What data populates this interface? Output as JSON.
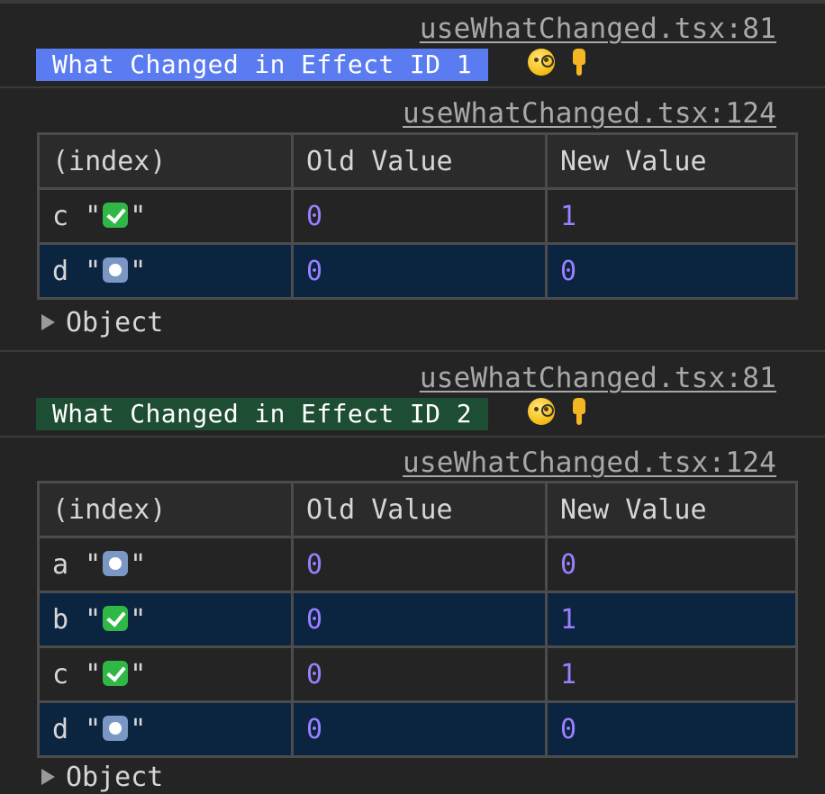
{
  "groups": [
    {
      "log_source": "useWhatChanged.tsx:81",
      "badge_text": "What Changed in Effect ID 1",
      "badge_color": "#5a7cf0",
      "table_source": "useWhatChanged.tsx:124",
      "columns": [
        "(index)",
        "Old Value",
        "New Value"
      ],
      "rows": [
        {
          "key": "c",
          "status_icon": "check-mark-icon",
          "old": "0",
          "new": "1"
        },
        {
          "key": "d",
          "status_icon": "record-button-icon",
          "old": "0",
          "new": "0"
        }
      ],
      "object_label": "Object"
    },
    {
      "log_source": "useWhatChanged.tsx:81",
      "badge_text": "What Changed in Effect ID 2",
      "badge_color": "#1d4d33",
      "table_source": "useWhatChanged.tsx:124",
      "columns": [
        "(index)",
        "Old Value",
        "New Value"
      ],
      "rows": [
        {
          "key": "a",
          "status_icon": "record-button-icon",
          "old": "0",
          "new": "0"
        },
        {
          "key": "b",
          "status_icon": "check-mark-icon",
          "old": "0",
          "new": "1"
        },
        {
          "key": "c",
          "status_icon": "check-mark-icon",
          "old": "0",
          "new": "1"
        },
        {
          "key": "d",
          "status_icon": "record-button-icon",
          "old": "0",
          "new": "0"
        }
      ],
      "object_label": "Object"
    }
  ],
  "quote_char": "\""
}
